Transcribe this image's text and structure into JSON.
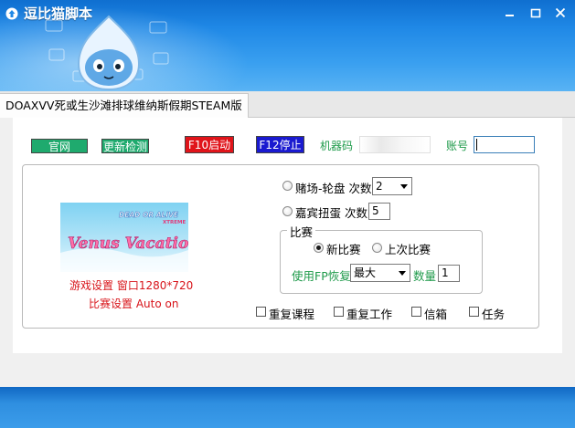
{
  "window": {
    "title": "逗比猫脚本",
    "controls": {
      "minimize": "minimize-icon",
      "maximize": "maximize-icon",
      "close": "close-icon"
    }
  },
  "tab": {
    "label": "DOAXVV死或生沙滩排球维纳斯假期STEAM版"
  },
  "top_row": {
    "official_site": "官网",
    "update_check": "更新检测",
    "start": "F10启动",
    "stop": "F12停止",
    "machine_code_label": "机器码",
    "machine_code_value": "",
    "account_label": "账号",
    "account_value": ""
  },
  "banner": {
    "line1": "DEAD OR ALIVE",
    "line2": "XTREME",
    "line3": "Venus Vacation"
  },
  "settings_text": {
    "game": "游戏设置 窗口1280*720",
    "match": "比赛设置 Auto on"
  },
  "options": {
    "casino": {
      "label": "赌场-轮盘 次数",
      "value": "2"
    },
    "gacha": {
      "label": "嘉宾扭蛋 次数",
      "value": "5"
    }
  },
  "match_group": {
    "title": "比赛",
    "new_match": "新比赛",
    "last_match": "上次比赛",
    "fp_label": "使用FP恢复",
    "fp_value": "最大",
    "qty_label": "数量",
    "qty_value": "1"
  },
  "checkboxes": [
    {
      "label": "重复课程"
    },
    {
      "label": "重复工作"
    },
    {
      "label": "信箱"
    },
    {
      "label": "任务"
    }
  ],
  "colors": {
    "title_bar": "#1f88e6",
    "green_button": "#1faa6e",
    "red_button": "#e0141a",
    "blue_button": "#1a1ad0",
    "green_label": "#1e9a4a",
    "red_text": "#d8141a"
  }
}
